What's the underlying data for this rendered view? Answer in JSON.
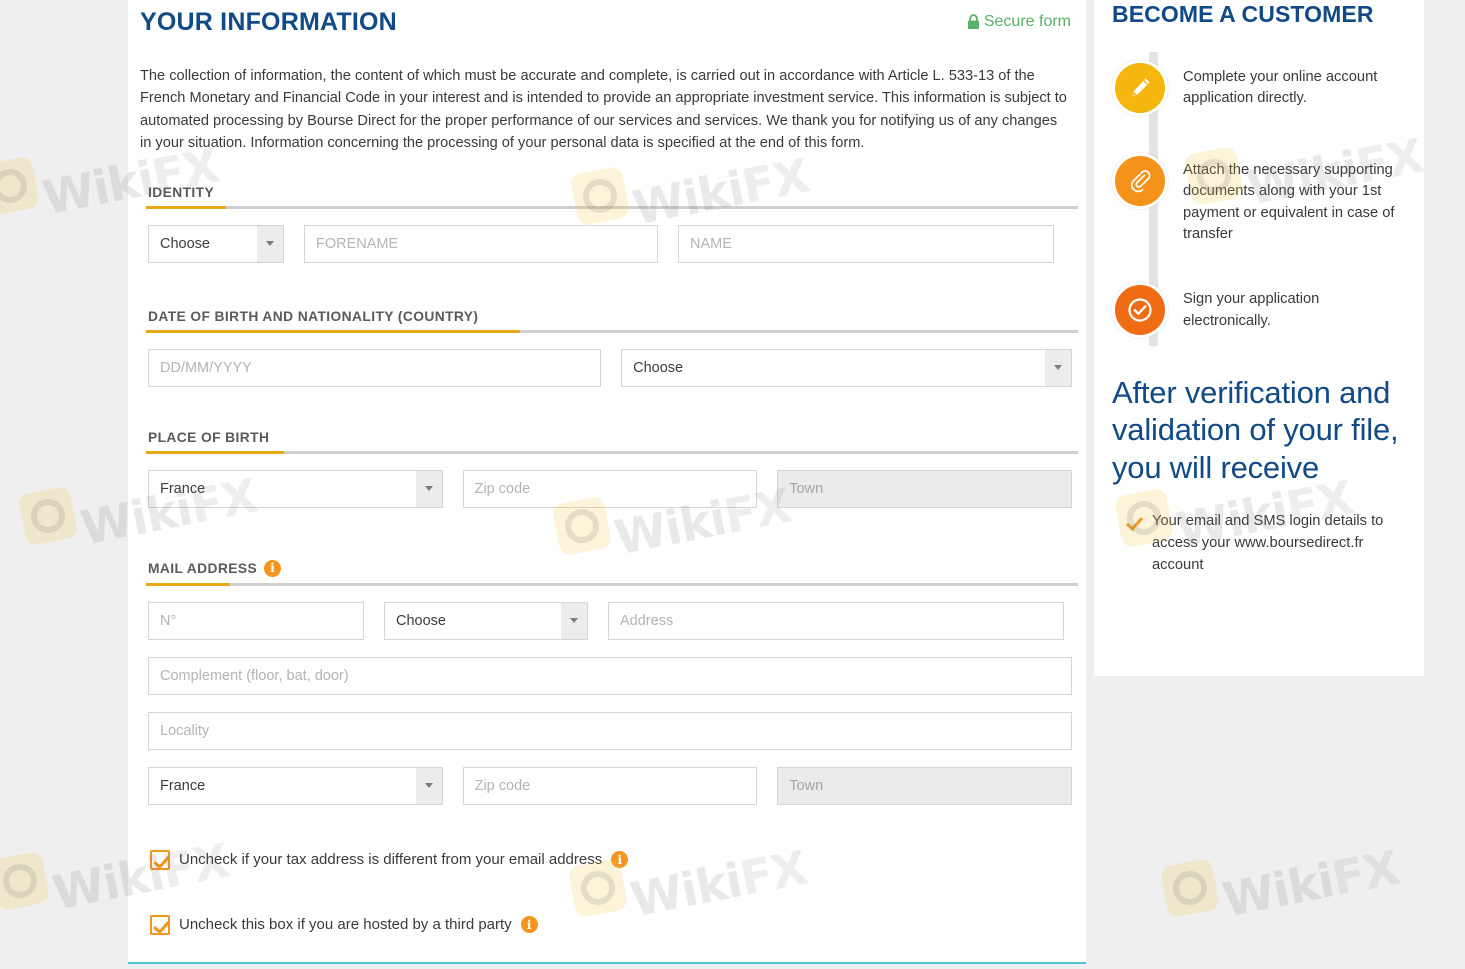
{
  "main": {
    "title": "YOUR INFORMATION",
    "secure_badge": {
      "label": "Secure form",
      "icon": "lock-icon",
      "color": "#59b06a"
    },
    "intro_text": "The collection of information, the content of which must be accurate and complete, is carried out in accordance with Article L. 533-13 of the French Monetary and Financial Code in your interest and is intended to provide an appropriate investment service. This information is subject to automated processing by Bourse Direct for the proper performance of our services and services. We thank you for notifying us of any changes in your situation. Information concerning the processing of your personal data is specified at the end of this form.",
    "sections": {
      "identity": {
        "heading": "IDENTITY",
        "civility_select": "Choose",
        "forename_placeholder": "FORENAME",
        "name_placeholder": "NAME"
      },
      "birth": {
        "heading": "DATE OF BIRTH AND NATIONALITY (COUNTRY)",
        "date_placeholder": "DD/MM/YYYY",
        "nationality_select": "Choose"
      },
      "place_of_birth": {
        "heading": "PLACE OF BIRTH",
        "country_select": "France",
        "zip_placeholder": "Zip code",
        "town_placeholder": "Town"
      },
      "mail_address": {
        "heading": "MAIL ADDRESS",
        "info_icon": "info-icon",
        "number_placeholder": "N°",
        "street_type_select": "Choose",
        "address_placeholder": "Address",
        "complement_placeholder": "Complement (floor, bat, door)",
        "locality_placeholder": "Locality",
        "country_select": "France",
        "zip_placeholder": "Zip code",
        "town_placeholder": "Town"
      }
    },
    "checkboxes": [
      {
        "label": "Uncheck if your tax address is different from your email address",
        "checked": true,
        "has_info": true
      },
      {
        "label": "Uncheck this box if you are hosted by a third party",
        "checked": true,
        "has_info": true
      }
    ]
  },
  "sidebar": {
    "title": "BECOME A CUSTOMER",
    "steps": [
      {
        "icon": "pencil-icon",
        "color": "#f5b70d",
        "text": "Complete your online account application directly."
      },
      {
        "icon": "paperclip-icon",
        "color": "#f59219",
        "text": "Attach the necessary supporting documents along with your 1st payment or equivalent in case of transfer"
      },
      {
        "icon": "check-circle-icon",
        "color": "#ef6c13",
        "text": "Sign your application electronically."
      }
    ],
    "after_heading": "After verification and validation of your file, you will receive",
    "bullets": [
      {
        "icon": "check-icon",
        "text": "Your email and SMS login details to access your www.boursedirect.fr account"
      }
    ]
  },
  "theme": {
    "brand_blue": "#114a87",
    "accent_gold": "#e8a917",
    "accent_orange": "#f3951e",
    "secure_green": "#59b06a",
    "page_bg": "#efefef",
    "bottom_rule": "#4fc3cf"
  },
  "watermark": {
    "text_a": "Wiki",
    "text_b": "FX"
  }
}
